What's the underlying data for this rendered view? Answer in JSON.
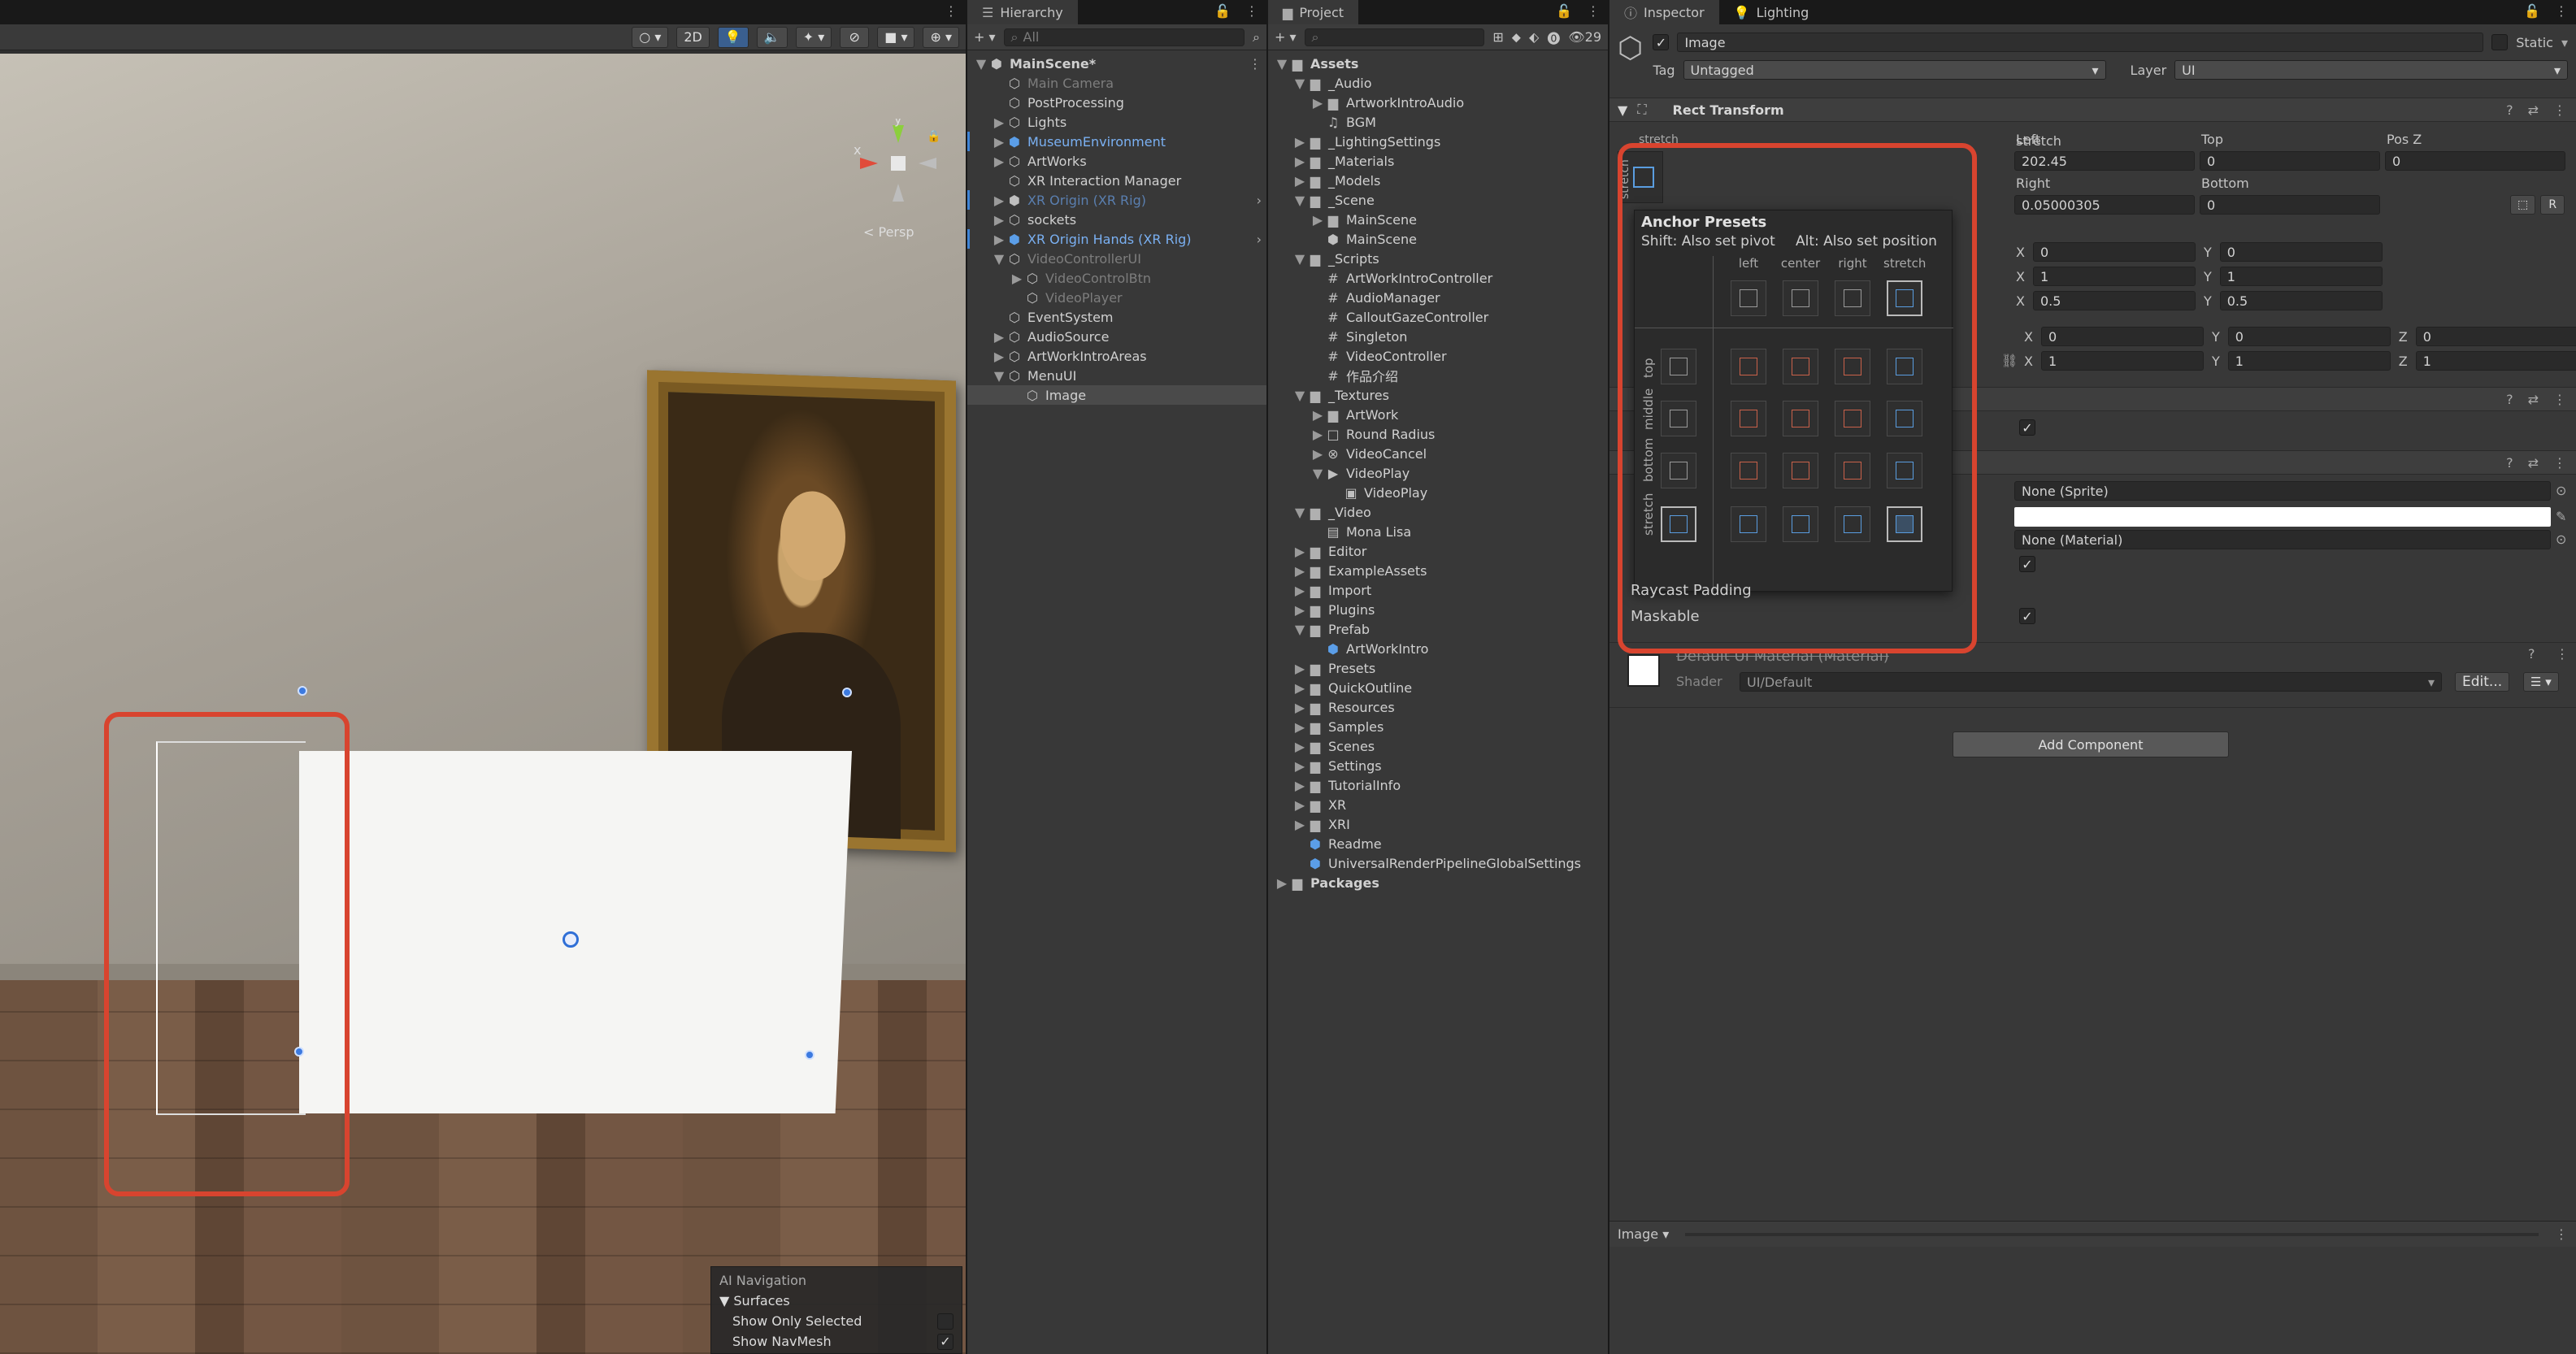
{
  "scene": {
    "tools": {
      "gizmo_circle": "○",
      "mode_2d": "2D"
    },
    "persp_label": "< Persp",
    "gizmo": {
      "y": "y",
      "x": "x"
    },
    "ai_nav": {
      "title": "AI Navigation",
      "surfaces": "Surfaces",
      "show_only_selected": "Show Only Selected",
      "show_navmesh": "Show NavMesh"
    }
  },
  "hierarchy": {
    "tab": "Hierarchy",
    "search_placeholder": "All",
    "nodes": [
      {
        "label": "MainScene*",
        "depth": 0,
        "arrow": "▼",
        "icon": "⬢",
        "style": "bold"
      },
      {
        "label": "Main Camera",
        "depth": 1,
        "arrow": "",
        "icon": "⬡",
        "style": "dim"
      },
      {
        "label": "PostProcessing",
        "depth": 1,
        "arrow": "",
        "icon": "⬡",
        "style": ""
      },
      {
        "label": "Lights",
        "depth": 1,
        "arrow": "▶",
        "icon": "⬡",
        "style": ""
      },
      {
        "label": "MuseumEnvironment",
        "depth": 1,
        "arrow": "▶",
        "icon": "⬢",
        "style": "prefab",
        "mod": true
      },
      {
        "label": "ArtWorks",
        "depth": 1,
        "arrow": "▶",
        "icon": "⬡",
        "style": ""
      },
      {
        "label": "XR Interaction Manager",
        "depth": 1,
        "arrow": "",
        "icon": "⬡",
        "style": ""
      },
      {
        "label": "XR Origin (XR Rig)",
        "depth": 1,
        "arrow": "▶",
        "icon": "⬢",
        "style": "dimprefab",
        "more": "›",
        "mod": true
      },
      {
        "label": "sockets",
        "depth": 1,
        "arrow": "▶",
        "icon": "⬡",
        "style": ""
      },
      {
        "label": "XR Origin Hands (XR Rig)",
        "depth": 1,
        "arrow": "▶",
        "icon": "⬢",
        "style": "prefab",
        "more": "›",
        "mod": true
      },
      {
        "label": "VideoControllerUI",
        "depth": 1,
        "arrow": "▼",
        "icon": "⬡",
        "style": "dim"
      },
      {
        "label": "VideoControlBtn",
        "depth": 2,
        "arrow": "▶",
        "icon": "⬡",
        "style": "dim"
      },
      {
        "label": "VideoPlayer",
        "depth": 2,
        "arrow": "",
        "icon": "⬡",
        "style": "dim"
      },
      {
        "label": "EventSystem",
        "depth": 1,
        "arrow": "",
        "icon": "⬡",
        "style": ""
      },
      {
        "label": "AudioSource",
        "depth": 1,
        "arrow": "▶",
        "icon": "⬡",
        "style": ""
      },
      {
        "label": "ArtWorkIntroAreas",
        "depth": 1,
        "arrow": "▶",
        "icon": "⬡",
        "style": ""
      },
      {
        "label": "MenuUI",
        "depth": 1,
        "arrow": "▼",
        "icon": "⬡",
        "style": ""
      },
      {
        "label": "Image",
        "depth": 2,
        "arrow": "",
        "icon": "⬡",
        "style": "sel"
      }
    ]
  },
  "project": {
    "tab": "Project",
    "hidden_count": "29",
    "nodes": [
      {
        "label": "Assets",
        "depth": 0,
        "arrow": "▼",
        "icon": "▆",
        "style": "bold"
      },
      {
        "label": "_Audio",
        "depth": 1,
        "arrow": "▼",
        "icon": "▆",
        "style": ""
      },
      {
        "label": "ArtworkIntroAudio",
        "depth": 2,
        "arrow": "▶",
        "icon": "▆",
        "style": ""
      },
      {
        "label": "BGM",
        "depth": 2,
        "arrow": "",
        "icon": "♫",
        "style": ""
      },
      {
        "label": "_LightingSettings",
        "depth": 1,
        "arrow": "▶",
        "icon": "▆",
        "style": ""
      },
      {
        "label": "_Materials",
        "depth": 1,
        "arrow": "▶",
        "icon": "▆",
        "style": ""
      },
      {
        "label": "_Models",
        "depth": 1,
        "arrow": "▶",
        "icon": "▆",
        "style": ""
      },
      {
        "label": "_Scene",
        "depth": 1,
        "arrow": "▼",
        "icon": "▆",
        "style": ""
      },
      {
        "label": "MainScene",
        "depth": 2,
        "arrow": "▶",
        "icon": "▆",
        "style": ""
      },
      {
        "label": "MainScene",
        "depth": 2,
        "arrow": "",
        "icon": "⬢",
        "style": ""
      },
      {
        "label": "_Scripts",
        "depth": 1,
        "arrow": "▼",
        "icon": "▆",
        "style": ""
      },
      {
        "label": "ArtWorkIntroController",
        "depth": 2,
        "arrow": "",
        "icon": "#",
        "style": ""
      },
      {
        "label": "AudioManager",
        "depth": 2,
        "arrow": "",
        "icon": "#",
        "style": ""
      },
      {
        "label": "CalloutGazeController",
        "depth": 2,
        "arrow": "",
        "icon": "#",
        "style": ""
      },
      {
        "label": "Singleton",
        "depth": 2,
        "arrow": "",
        "icon": "#",
        "style": ""
      },
      {
        "label": "VideoController",
        "depth": 2,
        "arrow": "",
        "icon": "#",
        "style": ""
      },
      {
        "label": "作品介绍",
        "depth": 2,
        "arrow": "",
        "icon": "#",
        "style": ""
      },
      {
        "label": "_Textures",
        "depth": 1,
        "arrow": "▼",
        "icon": "▆",
        "style": ""
      },
      {
        "label": "ArtWork",
        "depth": 2,
        "arrow": "▶",
        "icon": "▆",
        "style": ""
      },
      {
        "label": "Round Radius",
        "depth": 2,
        "arrow": "▶",
        "icon": "□",
        "style": ""
      },
      {
        "label": "VideoCancel",
        "depth": 2,
        "arrow": "▶",
        "icon": "⊗",
        "style": ""
      },
      {
        "label": "VideoPlay",
        "depth": 2,
        "arrow": "▼",
        "icon": "▶",
        "style": ""
      },
      {
        "label": "VideoPlay",
        "depth": 3,
        "arrow": "",
        "icon": "▣",
        "style": ""
      },
      {
        "label": "_Video",
        "depth": 1,
        "arrow": "▼",
        "icon": "▆",
        "style": ""
      },
      {
        "label": "Mona Lisa",
        "depth": 2,
        "arrow": "",
        "icon": "▤",
        "style": ""
      },
      {
        "label": "Editor",
        "depth": 1,
        "arrow": "▶",
        "icon": "▆",
        "style": ""
      },
      {
        "label": "ExampleAssets",
        "depth": 1,
        "arrow": "▶",
        "icon": "▆",
        "style": ""
      },
      {
        "label": "Import",
        "depth": 1,
        "arrow": "▶",
        "icon": "▆",
        "style": ""
      },
      {
        "label": "Plugins",
        "depth": 1,
        "arrow": "▶",
        "icon": "▆",
        "style": ""
      },
      {
        "label": "Prefab",
        "depth": 1,
        "arrow": "▼",
        "icon": "▆",
        "style": ""
      },
      {
        "label": "ArtWorkIntro",
        "depth": 2,
        "arrow": "",
        "icon": "⬢",
        "style": "prefabicon"
      },
      {
        "label": "Presets",
        "depth": 1,
        "arrow": "▶",
        "icon": "▆",
        "style": ""
      },
      {
        "label": "QuickOutline",
        "depth": 1,
        "arrow": "▶",
        "icon": "▆",
        "style": ""
      },
      {
        "label": "Resources",
        "depth": 1,
        "arrow": "▶",
        "icon": "▆",
        "style": ""
      },
      {
        "label": "Samples",
        "depth": 1,
        "arrow": "▶",
        "icon": "▆",
        "style": ""
      },
      {
        "label": "Scenes",
        "depth": 1,
        "arrow": "▶",
        "icon": "▆",
        "style": ""
      },
      {
        "label": "Settings",
        "depth": 1,
        "arrow": "▶",
        "icon": "▆",
        "style": ""
      },
      {
        "label": "TutorialInfo",
        "depth": 1,
        "arrow": "▶",
        "icon": "▆",
        "style": ""
      },
      {
        "label": "XR",
        "depth": 1,
        "arrow": "▶",
        "icon": "▆",
        "style": ""
      },
      {
        "label": "XRI",
        "depth": 1,
        "arrow": "▶",
        "icon": "▆",
        "style": ""
      },
      {
        "label": "Readme",
        "depth": 1,
        "arrow": "",
        "icon": "⬢",
        "style": "prefabicon"
      },
      {
        "label": "UniversalRenderPipelineGlobalSettings",
        "depth": 1,
        "arrow": "",
        "icon": "⬢",
        "style": "prefabicon"
      },
      {
        "label": "Packages",
        "depth": 0,
        "arrow": "▶",
        "icon": "▆",
        "style": "bold"
      }
    ]
  },
  "inspector": {
    "tabs": {
      "inspector": "Inspector",
      "lighting": "Lighting"
    },
    "object_name": "Image",
    "static_label": "Static",
    "tag_label": "Tag",
    "tag_value": "Untagged",
    "layer_label": "Layer",
    "layer_value": "UI",
    "rect_transform": "Rect Transform",
    "stretch_label": "stretch",
    "fields": {
      "left_label": "Left",
      "top_label": "Top",
      "posz_label": "Pos Z",
      "left": "202.45",
      "top": "0",
      "posz": "0",
      "right_label": "Right",
      "bottom_label": "Bottom",
      "right": "0.05000305",
      "bottom": "0",
      "anchor_min_x": "0",
      "anchor_min_y": "0",
      "anchor_max_x": "1",
      "anchor_max_y": "1",
      "pivot_x": "0.5",
      "pivot_y": "0.5",
      "rot_x": "0",
      "rot_y": "0",
      "rot_z": "0",
      "scale_x": "1",
      "scale_y": "1",
      "scale_z": "1",
      "x": "X",
      "y": "Y",
      "z": "Z"
    },
    "anchor_presets": {
      "title": "Anchor Presets",
      "shift_hint": "Shift: Also set pivot",
      "alt_hint": "Alt: Also set position",
      "cols": [
        "left",
        "center",
        "right",
        "stretch"
      ],
      "rows": [
        "top",
        "middle",
        "bottom",
        "stretch"
      ]
    },
    "image": {
      "source": "None (Sprite)",
      "material": "None (Material)",
      "raycast_padding": "Raycast Padding",
      "maskable": "Maskable"
    },
    "material": {
      "name": "Default UI Material (Material)",
      "shader_label": "Shader",
      "shader_value": "UI/Default",
      "edit": "Edit..."
    },
    "add_component": "Add Component",
    "preview_label": "Image ▾"
  },
  "colors": {
    "accent": "#3f84d6",
    "highlight": "#d8442f"
  }
}
